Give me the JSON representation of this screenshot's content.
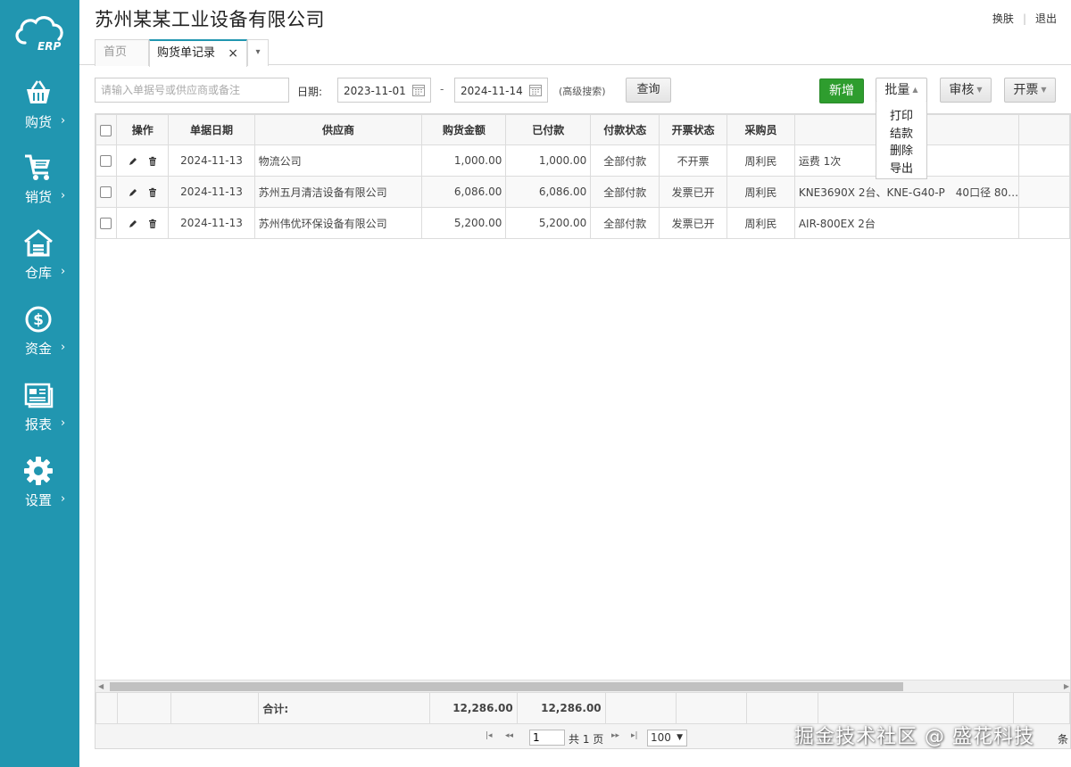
{
  "brand": {
    "logo_text": "ERP",
    "sidebar_color": "#2196b0",
    "accent_green": "#2e9d2e"
  },
  "sidebar": {
    "items": [
      {
        "label": "购货",
        "icon": "basket-icon"
      },
      {
        "label": "销货",
        "icon": "cart-icon"
      },
      {
        "label": "仓库",
        "icon": "warehouse-icon"
      },
      {
        "label": "资金",
        "icon": "dollar-icon"
      },
      {
        "label": "报表",
        "icon": "report-icon"
      },
      {
        "label": "设置",
        "icon": "gear-icon"
      }
    ],
    "arrow": "›"
  },
  "header": {
    "company": "苏州某某工业设备有限公司",
    "skin": "换肤",
    "logout": "退出"
  },
  "tabs": {
    "home": "首页",
    "active": "购货单记录",
    "close": "×",
    "more": "▾"
  },
  "toolbar": {
    "search_placeholder": "请输入单据号或供应商或备注",
    "date_label": "日期:",
    "date_from": "2023-11-01",
    "date_to": "2024-11-14",
    "date_dash": "-",
    "advanced": "(高级搜索)",
    "query": "查询",
    "add": "新增",
    "batch": "批量",
    "audit": "审核",
    "invoice": "开票"
  },
  "batch_menu": [
    "打印",
    "结款",
    "删除",
    "导出"
  ],
  "table": {
    "headers": [
      "操作",
      "单据日期",
      "供应商",
      "购货金额",
      "已付款",
      "付款状态",
      "开票状态",
      "采购员"
    ],
    "rows": [
      {
        "date": "2024-11-13",
        "supplier": "物流公司",
        "amount": "1,000.00",
        "paid": "1,000.00",
        "pay_status": "全部付款",
        "invoice_status": "不开票",
        "buyer": "周利民",
        "remark": "运费 1次"
      },
      {
        "date": "2024-11-13",
        "supplier": "苏州五月清洁设备有限公司",
        "amount": "6,086.00",
        "paid": "6,086.00",
        "pay_status": "全部付款",
        "invoice_status": "发票已开",
        "buyer": "周利民",
        "remark": "KNE3690X 2台、KNE-G40-P　40口径 80…"
      },
      {
        "date": "2024-11-13",
        "supplier": "苏州伟优环保设备有限公司",
        "amount": "5,200.00",
        "paid": "5,200.00",
        "pay_status": "全部付款",
        "invoice_status": "发票已开",
        "buyer": "周利民",
        "remark": "AIR-800EX 2台"
      }
    ],
    "footer": {
      "label": "合计:",
      "amount": "12,286.00",
      "paid": "12,286.00"
    }
  },
  "pager": {
    "first": "|◂",
    "prev": "◂◂",
    "page": "1",
    "total": "共 1 页",
    "next": "▸▸",
    "last": "▸|",
    "per_page": "100",
    "per_unit": "条"
  },
  "watermark": "掘金技术社区 @ 盛花科技"
}
